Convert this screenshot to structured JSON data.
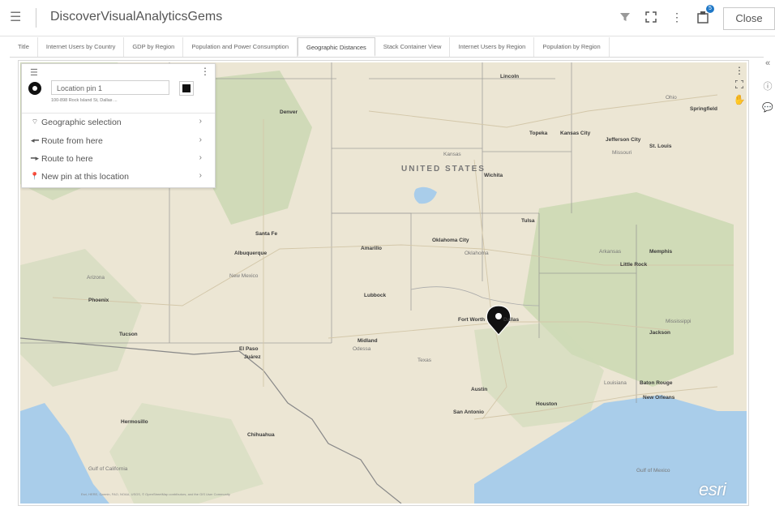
{
  "app": {
    "title": "DiscoverVisualAnalyticsGems",
    "close_label": "Close",
    "notification_count": "5"
  },
  "tabs": [
    {
      "label": "Title"
    },
    {
      "label": "Internet Users by Country"
    },
    {
      "label": "GDP by Region"
    },
    {
      "label": "Population and Power Consumption"
    },
    {
      "label": "Geographic Distances"
    },
    {
      "label": "Stack Container View"
    },
    {
      "label": "Internet Users by Region"
    },
    {
      "label": "Population by Region"
    }
  ],
  "popup": {
    "pin_name": "Location pin 1",
    "address": "100-898 Rock Island St, Dallas ...",
    "menu": [
      {
        "label": "Geographic selection",
        "icon": "geo-selection-icon"
      },
      {
        "label": "Route from here",
        "icon": "route-from-icon"
      },
      {
        "label": "Route to here",
        "icon": "route-to-icon"
      },
      {
        "label": "New pin at this location",
        "icon": "pin-icon"
      }
    ]
  },
  "map": {
    "country_label": "UNITED STATES",
    "cities": {
      "lincoln": "Lincoln",
      "denver": "Denver",
      "topeka": "Topeka",
      "kansas_city": "Kansas City",
      "jefferson_city": "Jefferson City",
      "st_louis": "St. Louis",
      "springfield": "Springfield",
      "ohio": "Ohio",
      "wichita": "Wichita",
      "kansas": "Kansas",
      "missouri": "Missouri",
      "tulsa": "Tulsa",
      "santa_fe": "Santa Fe",
      "albuquerque": "Albuquerque",
      "amarillo": "Amarillo",
      "oklahoma_city": "Oklahoma City",
      "oklahoma": "Oklahoma",
      "arkansas": "Arkansas",
      "memphis": "Memphis",
      "little_rock": "Little Rock",
      "arizona": "Arizona",
      "new_mexico": "New Mexico",
      "phoenix": "Phoenix",
      "lubbock": "Lubbock",
      "fort_worth": "Fort Worth",
      "dallas": "Dallas",
      "tucson": "Tucson",
      "el_paso": "El Paso",
      "juarez": "Juárez",
      "midland": "Midland",
      "odessa": "Odessa",
      "texas": "Texas",
      "jackson": "Jackson",
      "mississippi": "Mississippi",
      "louisiana": "Louisiana",
      "baton_rouge": "Baton Rouge",
      "new_orleans": "New Orleans",
      "austin": "Austin",
      "houston": "Houston",
      "san_antonio": "San Antonio",
      "hermosillo": "Hermosillo",
      "chihuahua": "Chihuahua",
      "gulf_of_california": "Gulf of California",
      "gulf_of_mexico": "Gulf of Mexico"
    },
    "attribution": "Esri, HERE, Garmin, FAO, NOAA, USGS, © OpenStreetMap contributors, and the GIS User Community",
    "logo": "esri"
  },
  "colors": {
    "land": "#ebe5d3",
    "water": "#a9cdea",
    "border": "#9a9a9a",
    "accent": "#1f78c7"
  }
}
